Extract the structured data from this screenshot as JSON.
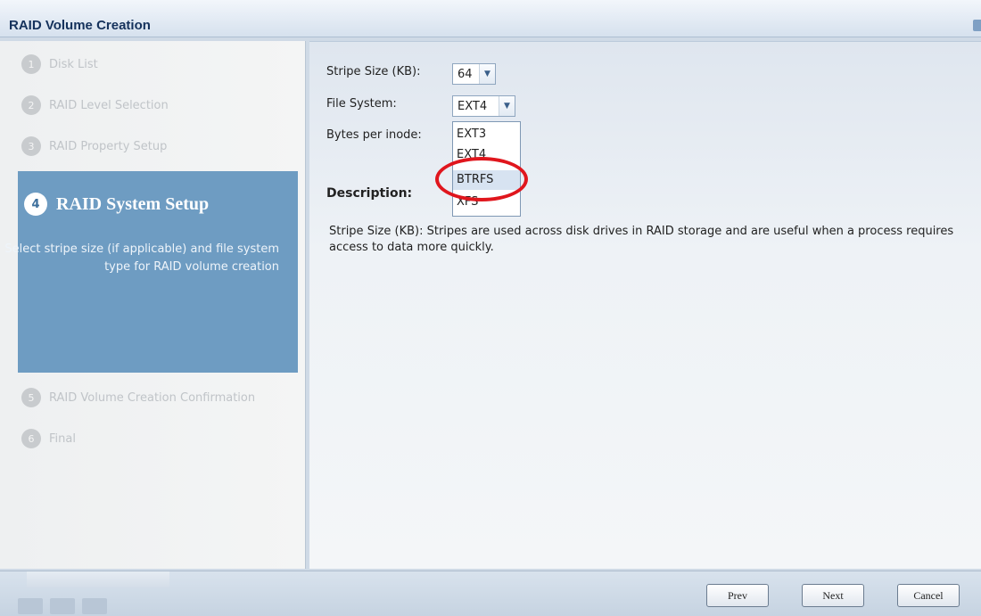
{
  "window": {
    "title": "RAID Volume Creation"
  },
  "wizard": {
    "steps": [
      {
        "num": "1",
        "label": "Disk List"
      },
      {
        "num": "2",
        "label": "RAID Level Selection"
      },
      {
        "num": "3",
        "label": "RAID Property Setup"
      },
      {
        "num": "4",
        "label": "RAID System Setup",
        "description": "Select stripe size (if applicable) and file system type for RAID volume creation"
      },
      {
        "num": "5",
        "label": "RAID Volume Creation Confirmation"
      },
      {
        "num": "6",
        "label": "Final"
      }
    ],
    "active_index": 3
  },
  "form": {
    "stripe_size_label": "Stripe Size (KB):",
    "stripe_size_value": "64",
    "file_system_label": "File System:",
    "file_system_value": "EXT4",
    "bytes_per_inode_label": "Bytes per inode:",
    "file_system_options": [
      "EXT3",
      "EXT4",
      "BTRFS",
      "XFS"
    ],
    "highlighted_option": "BTRFS",
    "description_heading": "Description:",
    "description_text": "Stripe Size (KB): Stripes are used across disk drives in RAID storage and are useful when a process requires access to data more quickly."
  },
  "buttons": {
    "prev": "Prev",
    "next": "Next",
    "cancel": "Cancel"
  },
  "colors": {
    "active_step": "#6e9cc2",
    "annotation": "#e0161d",
    "dropdown_highlight": "#d7e3f1"
  }
}
